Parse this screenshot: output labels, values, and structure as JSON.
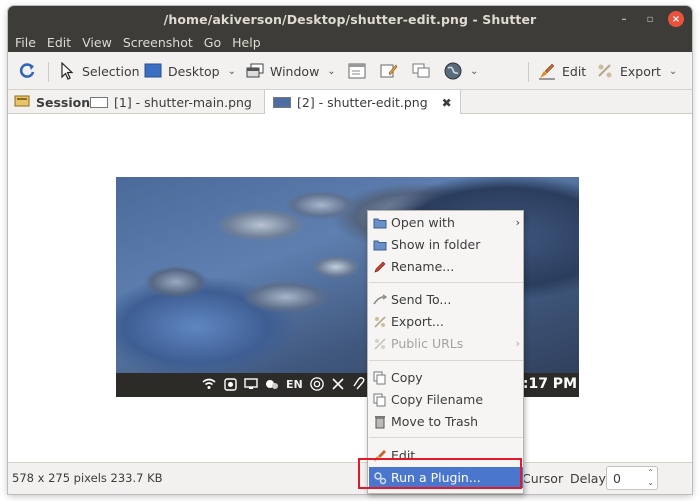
{
  "window": {
    "title": "/home/akiverson/Desktop/shutter-edit.png - Shutter"
  },
  "menu": [
    "File",
    "Edit",
    "View",
    "Screenshot",
    "Go",
    "Help"
  ],
  "toolbar": {
    "selection": "Selection",
    "desktop": "Desktop",
    "window": "Window",
    "edit": "Edit",
    "export": "Export"
  },
  "tabs": {
    "session": "Session",
    "tab1": "[1] - shutter-main.png",
    "tab2": "[2] - shutter-edit.png"
  },
  "screenshot": {
    "clock": "3:17 PM",
    "lang": "EN"
  },
  "context_menu": {
    "items": [
      {
        "label": "Open with",
        "icon": "folder-icon",
        "submenu": true,
        "enabled": true
      },
      {
        "label": "Show in folder",
        "icon": "folder-icon",
        "submenu": false,
        "enabled": true
      },
      {
        "label": "Rename...",
        "icon": "pencil-icon",
        "submenu": false,
        "enabled": true
      },
      {
        "label": "Send To...",
        "icon": "send-icon",
        "submenu": false,
        "enabled": true
      },
      {
        "label": "Export...",
        "icon": "export-icon",
        "submenu": false,
        "enabled": true
      },
      {
        "label": "Public URLs",
        "icon": "link-icon",
        "submenu": true,
        "enabled": false
      },
      {
        "label": "Copy",
        "icon": "copy-icon",
        "submenu": false,
        "enabled": true
      },
      {
        "label": "Copy Filename",
        "icon": "copy-icon",
        "submenu": false,
        "enabled": true
      },
      {
        "label": "Move to Trash",
        "icon": "trash-icon",
        "submenu": false,
        "enabled": true
      },
      {
        "label": "Edit...",
        "icon": "edit-icon",
        "submenu": false,
        "enabled": true
      },
      {
        "label": "Run a Plugin...",
        "icon": "plugin-icon",
        "submenu": false,
        "enabled": true,
        "highlighted": true
      }
    ]
  },
  "status": {
    "info": "578 x 275 pixels  233.7 KB",
    "cursor": "Cursor",
    "delay_label": "Delay:",
    "delay_value": "0"
  },
  "colors": {
    "titlebar": "#3d3c38",
    "highlight": "#4a76cd",
    "annotation": "#e0192b"
  }
}
